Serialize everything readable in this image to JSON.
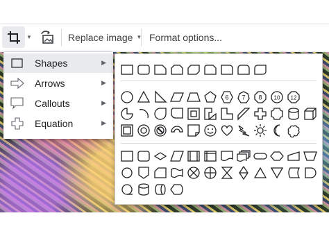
{
  "toolbar": {
    "crop_icon": "crop-icon",
    "crop_dropdown_icon": "caret-down-icon",
    "reset_icon": "reset-image-icon",
    "replace_label": "Replace image",
    "format_label": "Format options..."
  },
  "mask_menu": {
    "items": [
      {
        "label": "Shapes",
        "icon": "rectangle-icon",
        "active": true
      },
      {
        "label": "Arrows",
        "icon": "right-arrow-icon",
        "active": false
      },
      {
        "label": "Callouts",
        "icon": "callout-icon",
        "active": false
      },
      {
        "label": "Equation",
        "icon": "plus-icon",
        "active": false
      }
    ],
    "submenu_icon": "triangle-right-icon"
  },
  "shapes_panel": {
    "sections": [
      "rectangles",
      "basic-shapes",
      "flowchart"
    ],
    "numbered_shapes": [
      "6",
      "7",
      "8",
      "10",
      "12"
    ]
  },
  "colors": {
    "stroke": "#202124",
    "active_bg": "#e8eaed",
    "divider": "#dadce0"
  }
}
